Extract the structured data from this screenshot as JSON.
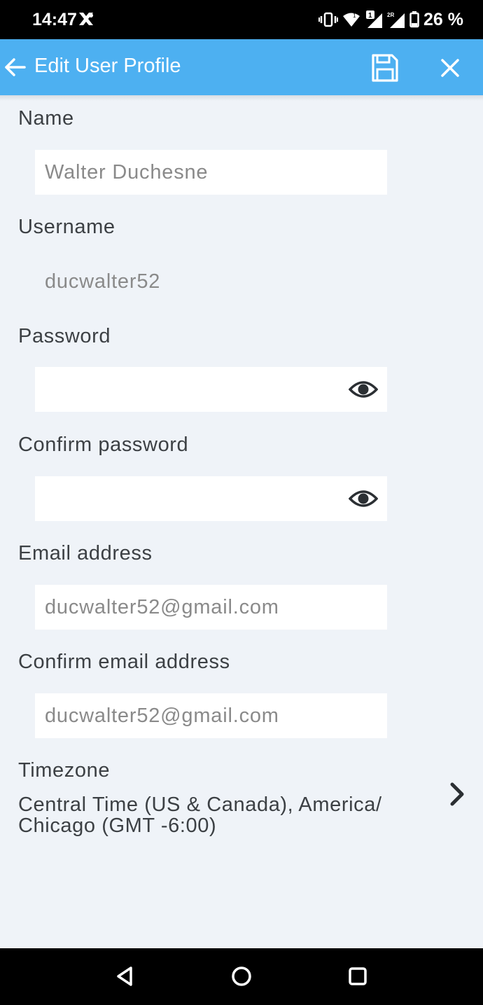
{
  "status_bar": {
    "time": "14:47",
    "battery": "26 %",
    "icons": [
      "app-notification-icon",
      "vibrate-icon",
      "wifi-icon",
      "sim1-signal-icon",
      "sim2-signal-icon",
      "battery-icon"
    ]
  },
  "app_bar": {
    "title": "Edit User Profile",
    "back_icon": "arrow-left-icon",
    "save_icon": "floppy-disk-icon",
    "close_icon": "close-icon",
    "background": "#4db0f1"
  },
  "form": {
    "name": {
      "label": "Name",
      "value": "Walter Duchesne"
    },
    "username": {
      "label": "Username",
      "value": "ducwalter52"
    },
    "password": {
      "label": "Password",
      "value": ""
    },
    "confirm_password": {
      "label": "Confirm password",
      "value": ""
    },
    "email": {
      "label": "Email address",
      "value": "ducwalter52@gmail.com"
    },
    "confirm_email": {
      "label": "Confirm email address",
      "value": "ducwalter52@gmail.com"
    },
    "timezone": {
      "label": "Timezone",
      "value": "Central Time (US & Canada), America/ Chicago (GMT -6:00)"
    }
  },
  "nav_bar": {
    "icons": [
      "back-triangle-icon",
      "home-circle-icon",
      "recents-square-icon"
    ]
  }
}
